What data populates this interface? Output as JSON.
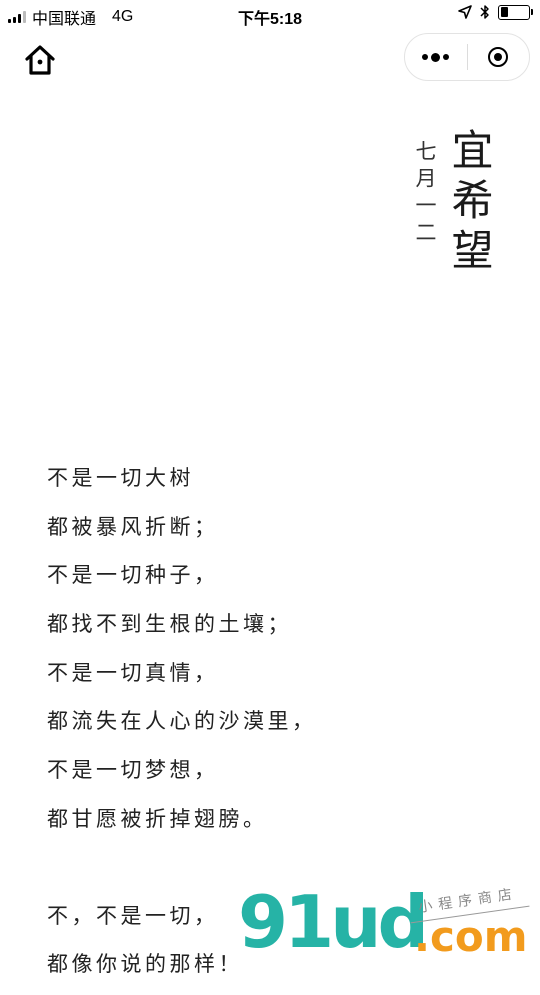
{
  "status_bar": {
    "carrier": "中国联通",
    "network": "4G",
    "time": "下午5:18",
    "battery_level": 0.3
  },
  "icons": {
    "home": "home-icon",
    "more": "more-dots-icon",
    "close": "close-circle-icon",
    "location": "location-arrow-icon",
    "bluetooth": "bluetooth-icon"
  },
  "header": {
    "title": "宜希望",
    "date": "七月一二"
  },
  "poem": {
    "stanza1": [
      "不是一切大树",
      "都被暴风折断；",
      "不是一切种子，",
      "都找不到生根的土壤；",
      "不是一切真情，",
      "都流失在人心的沙漠里，",
      "不是一切梦想，",
      "都甘愿被折掉翅膀。"
    ],
    "stanza2": [
      "不，不是一切，",
      "都像你说的那样！"
    ]
  },
  "watermark": {
    "main": "91ud",
    "suffix": ".com",
    "sub": "小程序商店"
  },
  "colors": {
    "watermark_teal": "#26b3a6",
    "watermark_orange": "#f29b1d"
  }
}
